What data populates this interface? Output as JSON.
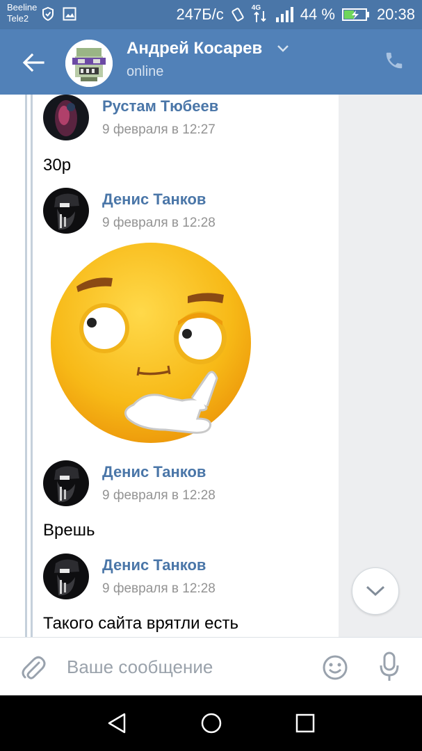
{
  "status_bar": {
    "carrier1": "Beeline",
    "carrier2": "Tele2",
    "speed": "247Б/с",
    "network": "4G",
    "battery": "44 %",
    "time": "20:38"
  },
  "header": {
    "name": "Андрей Косарев",
    "status": "online"
  },
  "messages": [
    {
      "author": "Рустам Тюбеев",
      "time": "9 февраля в 12:27",
      "text": "30р"
    },
    {
      "author": "Денис Танков",
      "time": "9 февраля в 12:28",
      "sticker": "thinking-face-sticker"
    },
    {
      "author": "Денис Танков",
      "time": "9 февраля в 12:28",
      "text": "Врешь"
    },
    {
      "author": "Денис Танков",
      "time": "9 февраля в 12:28",
      "text": "Такого сайта врятли есть"
    }
  ],
  "composer": {
    "placeholder": "Ваше сообщение"
  },
  "colors": {
    "appbar": "#5181b8",
    "statusbar": "#4a76a8",
    "author": "#4a76a8",
    "feed_bg": "#edeef0"
  }
}
